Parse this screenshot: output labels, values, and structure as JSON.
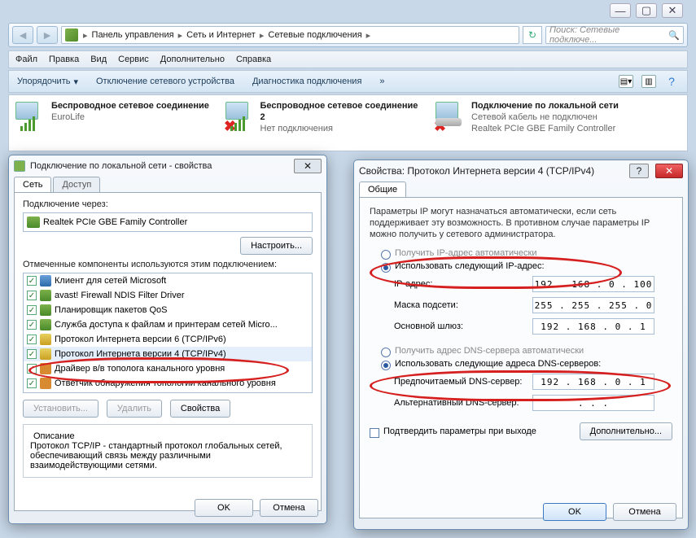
{
  "wincontrols": {
    "min": "—",
    "max": "▢",
    "close": "✕"
  },
  "breadcrumb": {
    "c1": "Панель управления",
    "c2": "Сеть и Интернет",
    "c3": "Сетевые подключения"
  },
  "search": {
    "placeholder": "Поиск: Сетевые подключе..."
  },
  "menu": {
    "file": "Файл",
    "edit": "Правка",
    "view": "Вид",
    "service": "Сервис",
    "extra": "Дополнительно",
    "help": "Справка"
  },
  "toolbar": {
    "org": "Упорядочить",
    "disable": "Отключение сетевого устройства",
    "diag": "Диагностика подключения"
  },
  "netitems": [
    {
      "t1": "Беспроводное сетевое соединение",
      "t2": "EuroLife",
      "t3": ""
    },
    {
      "t1": "Беспроводное сетевое соединение 2",
      "t2": "Нет подключения",
      "t3": ""
    },
    {
      "t1": "Подключение по локальной сети",
      "t2": "Сетевой кабель не подключен",
      "t3": "Realtek PCIe GBE Family Controller"
    }
  ],
  "dlgLeft": {
    "title": "Подключение по локальной сети - свойства",
    "tabs": {
      "net": "Сеть",
      "access": "Доступ"
    },
    "connLabel": "Подключение через:",
    "adapter": "Realtek PCIe GBE Family Controller",
    "configure": "Настроить...",
    "compLabel": "Отмеченные компоненты используются этим подключением:",
    "components": [
      "Клиент для сетей Microsoft",
      "avast! Firewall NDIS Filter Driver",
      "Планировщик пакетов QoS",
      "Служба доступа к файлам и принтерам сетей Micro...",
      "Протокол Интернета версии 6 (TCP/IPv6)",
      "Протокол Интернета версии 4 (TCP/IPv4)",
      "Драйвер в/в тополога канального уровня",
      "Ответчик обнаружения топологии канального уровня"
    ],
    "install": "Установить...",
    "remove": "Удалить",
    "props": "Свойства",
    "descTitle": "Описание",
    "desc": "Протокол TCP/IP - стандартный протокол глобальных сетей, обеспечивающий связь между различными взаимодействующими сетями.",
    "ok": "OK",
    "cancel": "Отмена"
  },
  "dlgRight": {
    "title": "Свойства: Протокол Интернета версии 4 (TCP/IPv4)",
    "tab": "Общие",
    "info": "Параметры IP могут назначаться автоматически, если сеть поддерживает эту возможность. В противном случае параметры IP можно получить у сетевого администратора.",
    "ipAuto": "Получить IP-адрес автоматически",
    "ipManual": "Использовать следующий IP-адрес:",
    "ipaddrLabel": "IP-адрес:",
    "ipaddr": "192 . 168 .  0  . 100",
    "maskLabel": "Маска подсети:",
    "mask": "255 . 255 . 255 .  0",
    "gwLabel": "Основной шлюз:",
    "gw": "192 . 168 .  0  .  1",
    "dnsAuto": "Получить адрес DNS-сервера автоматически",
    "dnsManual": "Использовать следующие адреса DNS-серверов:",
    "dns1Label": "Предпочитаемый DNS-сервер:",
    "dns1": "192 . 168 .  0  .  1",
    "dns2Label": "Альтернативный DNS-сервер:",
    "dns2": " .       .       .",
    "confirm": "Подтвердить параметры при выходе",
    "advanced": "Дополнительно...",
    "ok": "OK",
    "cancel": "Отмена"
  }
}
